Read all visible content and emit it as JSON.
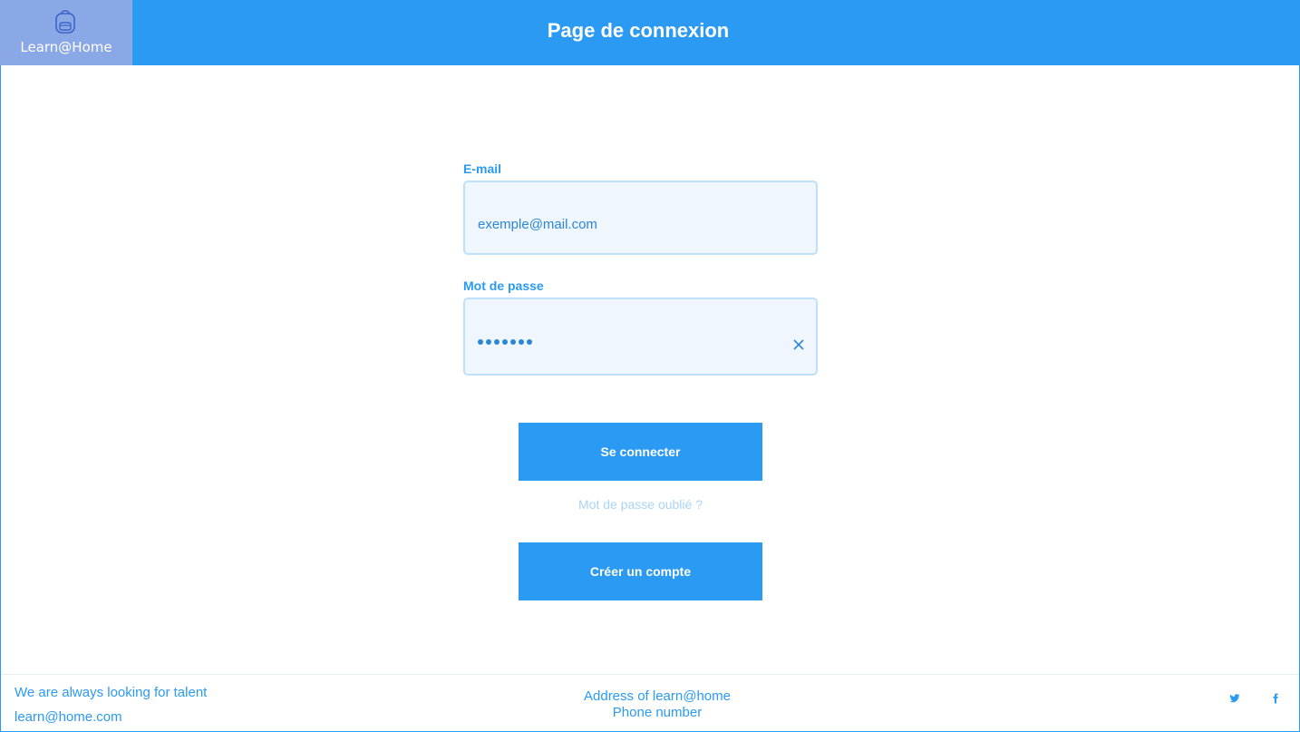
{
  "header": {
    "logo_text": "Learn@Home",
    "title": "Page de connexion"
  },
  "form": {
    "email": {
      "label": "E-mail",
      "value": "exemple@mail.com"
    },
    "password": {
      "label": "Mot de passe",
      "masked_length": 7
    },
    "login_button": "Se connecter",
    "forgot_link": "Mot de passe oublié ?",
    "create_button": "Créer un compte"
  },
  "footer": {
    "tagline": "We are always looking for talent",
    "email": "learn@home.com",
    "address": "Address of learn@home",
    "phone": "Phone number",
    "icons": [
      "twitter-icon",
      "facebook-icon"
    ]
  },
  "colors": {
    "primary": "#2b9af3",
    "logo_bg": "#8aa8e6",
    "field_bg": "#eff6fd",
    "field_border": "#bfe0fb"
  }
}
